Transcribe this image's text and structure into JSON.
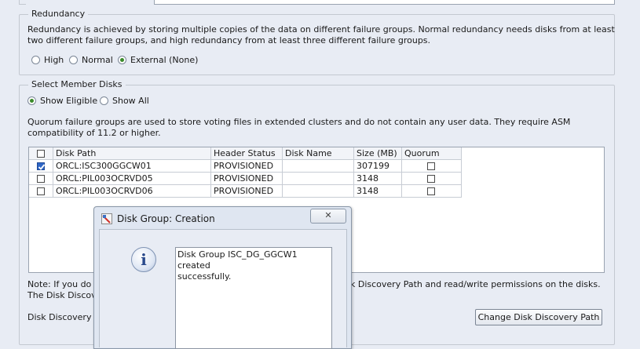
{
  "redundancy": {
    "legend": "Redundancy",
    "description_line1": "Redundancy is achieved by storing multiple copies of the data on different failure groups. Normal redundancy needs disks from at least",
    "description_line2": "two different failure groups, and high redundancy from at least three different failure groups.",
    "options": [
      "High",
      "Normal",
      "External (None)"
    ],
    "selected": "External (None)"
  },
  "member_disks": {
    "legend": "Select Member Disks",
    "filter_options": [
      "Show Eligible",
      "Show All"
    ],
    "selected_filter": "Show Eligible",
    "quorum_note_line1": "Quorum failure groups are used to store voting files in extended clusters and do not contain any user data. They require ASM",
    "quorum_note_line2": "compatibility of 11.2 or higher.",
    "table": {
      "columns": [
        "Disk Path",
        "Header Status",
        "Disk Name",
        "Size (MB)",
        "Quorum"
      ],
      "rows": [
        {
          "checked": true,
          "disk_path": "ORCL:ISC300GGCW01",
          "header_status": "PROVISIONED",
          "disk_name": "",
          "size": "307199",
          "quorum": false
        },
        {
          "checked": false,
          "disk_path": "ORCL:PIL003OCRVD05",
          "header_status": "PROVISIONED",
          "disk_name": "",
          "size": "3148",
          "quorum": false
        },
        {
          "checked": false,
          "disk_path": "ORCL:PIL003OCRVD06",
          "header_status": "PROVISIONED",
          "disk_name": "",
          "size": "3148",
          "quorum": false
        }
      ]
    },
    "note_left": "Note: If you do n",
    "note_right": "k Discovery Path and read/write permissions on the disks.",
    "note_line2_left": "The Disk Discov",
    "discovery_label": "Disk Discovery I",
    "change_path_button": "Change Disk Discovery Path"
  },
  "dialog": {
    "title": "Disk Group: Creation",
    "close_glyph": "✕",
    "info_glyph": "i",
    "message_line1": "Disk Group ISC_DG_GGCW1 created",
    "message_line2": "successfully."
  }
}
